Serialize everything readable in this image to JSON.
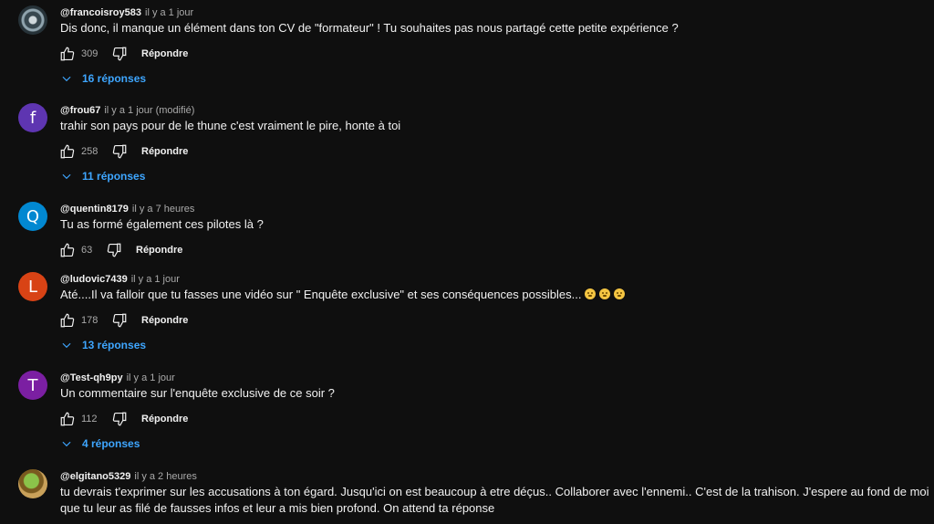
{
  "comments": [
    {
      "author": "@francoisroy583",
      "time": "il y a 1 jour",
      "text": "Dis donc, il manque un élément dans ton CV de \"formateur\" ! Tu souhaites pas nous partagé cette petite expérience ?",
      "likes": "309",
      "reply_label": "Répondre",
      "replies_label": "16 réponses",
      "avatar_letter": "",
      "avatar_color": "#263238"
    },
    {
      "author": "@frou67",
      "time": "il y a 1 jour (modifié)",
      "text": "trahir son pays pour de le thune c'est vraiment le pire, honte à toi",
      "likes": "258",
      "reply_label": "Répondre",
      "replies_label": "11 réponses",
      "avatar_letter": "f",
      "avatar_color": "#5e35b1"
    },
    {
      "author": "@quentin8179",
      "time": "il y a 7 heures",
      "text": "Tu as formé également ces pilotes là ?",
      "likes": "63",
      "reply_label": "Répondre",
      "replies_label": "",
      "avatar_letter": "Q",
      "avatar_color": "#0288d1"
    },
    {
      "author": "@ludovic7439",
      "time": "il y a 1 jour",
      "text": "Até....Il va falloir que tu fasses une vidéo sur \" Enquête exclusive\" et ses conséquences possibles...",
      "likes": "178",
      "reply_label": "Répondre",
      "replies_label": "13 réponses",
      "avatar_letter": "L",
      "avatar_color": "#d84315"
    },
    {
      "author": "@Test-qh9py",
      "time": "il y a 1 jour",
      "text": "Un commentaire sur l'enquête exclusive de ce soir ?",
      "likes": "112",
      "reply_label": "Répondre",
      "replies_label": "4 réponses",
      "avatar_letter": "T",
      "avatar_color": "#7b1fa2"
    },
    {
      "author": "@elgitano5329",
      "time": "il y a 2 heures",
      "text": "tu devrais t'exprimer sur les accusations à ton égard. Jusqu'ici on est beaucoup à etre déçus.. Collaborer avec l'ennemi.. C'est de la trahison. J'espere au fond de moi que tu leur as filé de fausses infos et leur a mis bien profond. On attend ta réponse",
      "likes": "",
      "reply_label": "",
      "replies_label": "",
      "avatar_letter": "",
      "avatar_color": "#7a5a1f"
    }
  ],
  "icons": {
    "like": "thumbs-up-icon",
    "dislike": "thumbs-down-icon",
    "expand": "chevron-down-icon",
    "emoji": "shushing-face-emoji"
  },
  "colors": {
    "background": "#0f0f0f",
    "link": "#3ea6ff",
    "secondary_text": "#aaaaaa"
  }
}
